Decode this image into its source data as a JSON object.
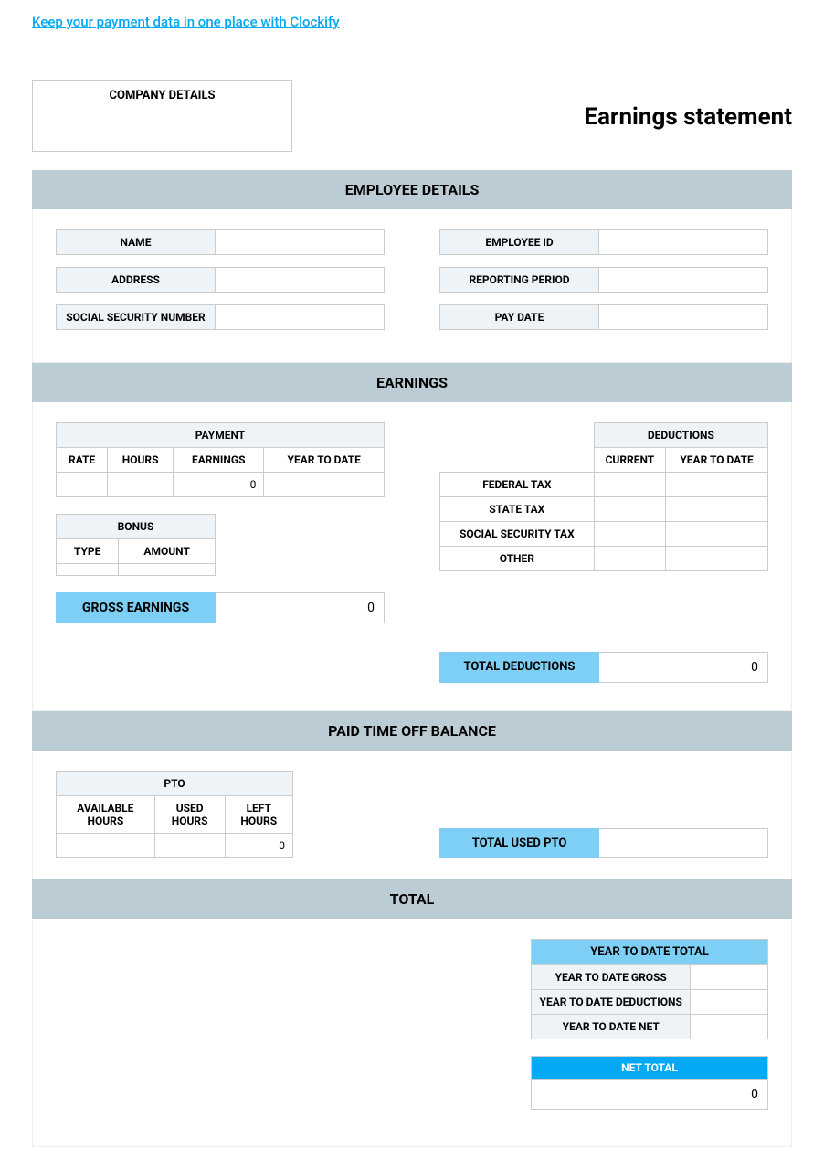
{
  "promo_link": "Keep your payment data in one place with Clockify",
  "company_box_label": "COMPANY DETAILS",
  "title": "Earnings statement",
  "sections": {
    "employee_details": "EMPLOYEE DETAILS",
    "earnings": "EARNINGS",
    "pto_balance": "PAID TIME OFF BALANCE",
    "total": "TOTAL"
  },
  "employee": {
    "name_label": "NAME",
    "name_value": "",
    "address_label": "ADDRESS",
    "address_value": "",
    "ssn_label": "SOCIAL SECURITY NUMBER",
    "ssn_value": "",
    "id_label": "EMPLOYEE ID",
    "id_value": "",
    "period_label": "REPORTING PERIOD",
    "period_value": "",
    "paydate_label": "PAY DATE",
    "paydate_value": ""
  },
  "payment": {
    "header": "PAYMENT",
    "col_rate": "RATE",
    "col_hours": "HOURS",
    "col_earnings": "EARNINGS",
    "col_ytd": "YEAR TO DATE",
    "row": {
      "rate": "",
      "hours": "",
      "earnings": "0",
      "ytd": ""
    }
  },
  "bonus": {
    "header": "BONUS",
    "col_type": "TYPE",
    "col_amount": "AMOUNT",
    "row": {
      "type": "",
      "amount": ""
    }
  },
  "deductions": {
    "header": "DEDUCTIONS",
    "col_current": "CURRENT",
    "col_ytd": "YEAR TO DATE",
    "rows": [
      {
        "label": "FEDERAL TAX",
        "current": "",
        "ytd": ""
      },
      {
        "label": "STATE TAX",
        "current": "",
        "ytd": ""
      },
      {
        "label": "SOCIAL SECURITY TAX",
        "current": "",
        "ytd": ""
      },
      {
        "label": "OTHER",
        "current": "",
        "ytd": ""
      }
    ]
  },
  "gross_earnings_label": "GROSS EARNINGS",
  "gross_earnings_value": "0",
  "total_deductions_label": "TOTAL DEDUCTIONS",
  "total_deductions_value": "0",
  "pto": {
    "header": "PTO",
    "col_available": "AVAILABLE HOURS",
    "col_used": "USED HOURS",
    "col_left": "LEFT HOURS",
    "row": {
      "available": "",
      "used": "",
      "left": "0"
    }
  },
  "total_used_pto_label": "TOTAL USED PTO",
  "total_used_pto_value": "",
  "ytd_total": {
    "header": "YEAR TO DATE TOTAL",
    "gross_label": "YEAR TO DATE GROSS",
    "gross_value": "",
    "ded_label": "YEAR TO DATE DEDUCTIONS",
    "ded_value": "",
    "net_label": "YEAR TO DATE NET",
    "net_value": ""
  },
  "net_total_label": "NET TOTAL",
  "net_total_value": "0"
}
